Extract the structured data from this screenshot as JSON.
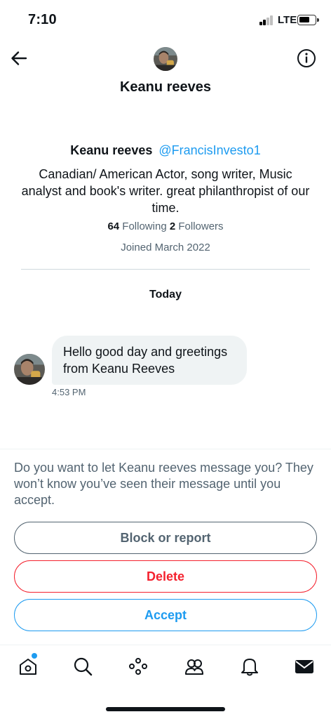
{
  "status_bar": {
    "time": "7:10",
    "network": "LTE"
  },
  "header": {
    "title": "Keanu reeves"
  },
  "profile": {
    "name": "Keanu reeves",
    "handle": "@FrancisInvesto1",
    "bio": "Canadian/ American Actor, song writer, Music analyst and book's writer. great philanthropist of our time.",
    "following_count": "64",
    "following_label": "Following",
    "followers_count": "2",
    "followers_label": "Followers",
    "joined": "Joined March 2022"
  },
  "conversation": {
    "day_label": "Today",
    "messages": [
      {
        "text": "Hello good day and greetings from Keanu Reeves",
        "time": "4:53 PM"
      }
    ]
  },
  "request": {
    "prompt": "Do you want to let Keanu reeves message you? They won’t know you’ve seen their message until you accept.",
    "block_label": "Block or report",
    "delete_label": "Delete",
    "accept_label": "Accept"
  },
  "tabs": [
    "home-icon",
    "search-icon",
    "spaces-icon",
    "communities-icon",
    "notifications-icon",
    "messages-icon"
  ],
  "colors": {
    "accent": "#1d9bf0",
    "danger": "#f4212e",
    "muted": "#536471",
    "bubble": "#eff3f4"
  }
}
